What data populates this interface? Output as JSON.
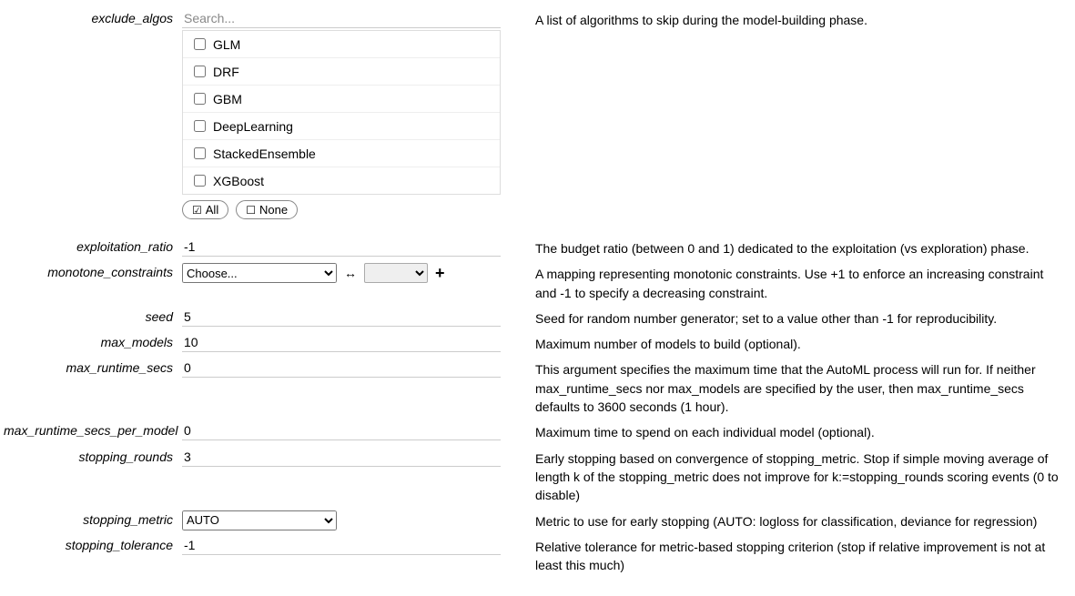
{
  "exclude_algos": {
    "label": "exclude_algos",
    "search_placeholder": "Search...",
    "items": [
      "GLM",
      "DRF",
      "GBM",
      "DeepLearning",
      "StackedEnsemble",
      "XGBoost"
    ],
    "all_label": "All",
    "none_label": "None",
    "desc": "A list of algorithms to skip during the model-building phase."
  },
  "exploitation_ratio": {
    "label": "exploitation_ratio",
    "value": "-1",
    "desc": "The budget ratio (between 0 and 1) dedicated to the exploitation (vs exploration) phase."
  },
  "monotone_constraints": {
    "label": "monotone_constraints",
    "choose_label": "Choose...",
    "desc": "A mapping representing monotonic constraints. Use +1 to enforce an increasing constraint and -1 to specify a decreasing constraint."
  },
  "seed": {
    "label": "seed",
    "value": "5",
    "desc": "Seed for random number generator; set to a value other than -1 for reproducibility."
  },
  "max_models": {
    "label": "max_models",
    "value": "10",
    "desc": "Maximum number of models to build (optional)."
  },
  "max_runtime_secs": {
    "label": "max_runtime_secs",
    "value": "0",
    "desc": "This argument specifies the maximum time that the AutoML process will run for. If neither max_runtime_secs nor max_models are specified by the user, then max_runtime_secs defaults to 3600 seconds (1 hour)."
  },
  "max_runtime_secs_per_model": {
    "label": "max_runtime_secs_per_model",
    "value": "0",
    "desc": "Maximum time to spend on each individual model (optional)."
  },
  "stopping_rounds": {
    "label": "stopping_rounds",
    "value": "3",
    "desc": "Early stopping based on convergence of stopping_metric. Stop if simple moving average of length k of the stopping_metric does not improve for k:=stopping_rounds scoring events (0 to disable)"
  },
  "stopping_metric": {
    "label": "stopping_metric",
    "value": "AUTO",
    "desc": "Metric to use for early stopping (AUTO: logloss for classification, deviance for regression)"
  },
  "stopping_tolerance": {
    "label": "stopping_tolerance",
    "value": "-1",
    "desc": "Relative tolerance for metric-based stopping criterion (stop if relative improvement is not at least this much)"
  }
}
